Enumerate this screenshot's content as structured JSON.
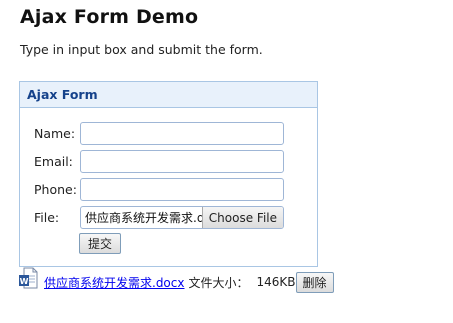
{
  "page": {
    "title": "Ajax Form Demo",
    "intro": "Type in input box and submit the form."
  },
  "form": {
    "header": "Ajax Form",
    "name_label": "Name:",
    "name_value": "",
    "email_label": "Email:",
    "email_value": "",
    "phone_label": "Phone:",
    "phone_value": "",
    "file_label": "File:",
    "file_name": "供应商系统开发需求.d",
    "choose_file_label": "Choose File",
    "submit_label": "提交"
  },
  "attachment": {
    "icon": "word-document-icon",
    "file_link": "供应商系统开发需求.docx",
    "size_label": "文件大小：",
    "size_value": "146KB",
    "delete_label": "删除"
  },
  "colors": {
    "panel_border": "#a9c6e4",
    "panel_header_bg": "#e8f1fb",
    "panel_header_text": "#15428b",
    "link": "#0000ee",
    "word_blue": "#2b579a"
  }
}
